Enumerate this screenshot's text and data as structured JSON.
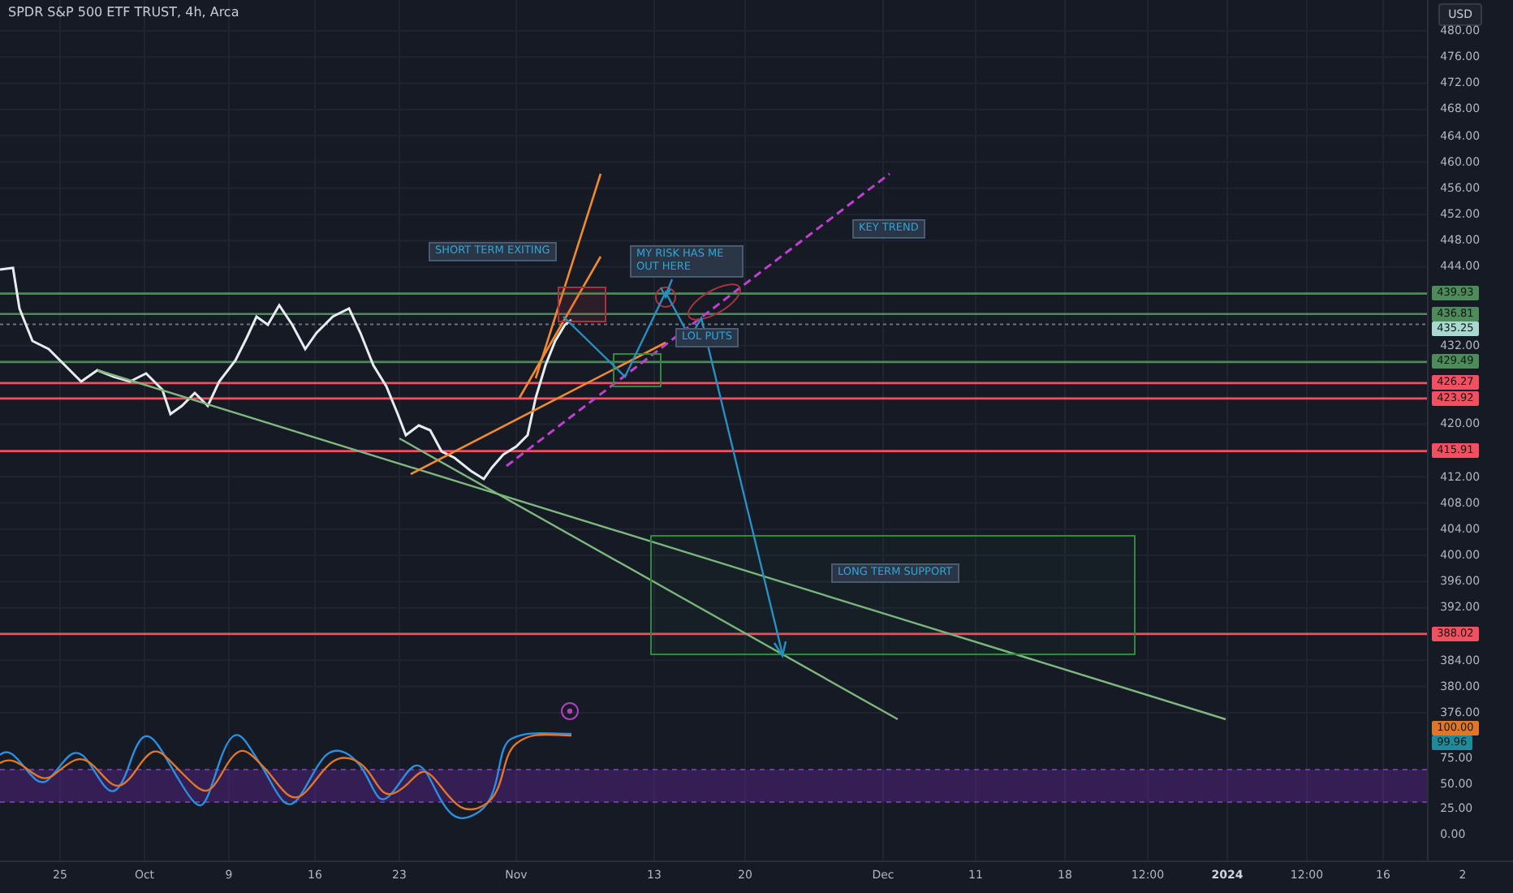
{
  "legend": {
    "title": "SPDR S&P 500 ETF TRUST, 4h, Arca"
  },
  "currency_button": "USD",
  "price_ticks": [
    "480.00",
    "476.00",
    "472.00",
    "468.00",
    "464.00",
    "460.00",
    "456.00",
    "452.00",
    "448.00",
    "444.00",
    "432.00",
    "420.00",
    "412.00",
    "408.00",
    "404.00",
    "400.00",
    "396.00",
    "392.00",
    "384.00",
    "380.00",
    "376.00"
  ],
  "levels": [
    {
      "label": "439.93",
      "color": "#4f8a5b",
      "kind": "solid"
    },
    {
      "label": "436.81",
      "color": "#4f8a5b",
      "kind": "solid"
    },
    {
      "label": "435.25",
      "color": "#a8d8d0",
      "kind": "dotted"
    },
    {
      "label": "429.49",
      "color": "#4f8a5b",
      "kind": "solid"
    },
    {
      "label": "426.27",
      "color": "#f05060",
      "kind": "solid"
    },
    {
      "label": "423.92",
      "color": "#f05060",
      "kind": "solid"
    },
    {
      "label": "415.91",
      "color": "#f05060",
      "kind": "solid"
    },
    {
      "label": "388.02",
      "color": "#f05060",
      "kind": "solid"
    }
  ],
  "oscillator": {
    "ticks": [
      "75.00",
      "50.00",
      "25.00",
      "0.00"
    ],
    "values": [
      {
        "label": "100.00",
        "color": "#e0762a"
      },
      {
        "label": "99.96",
        "color": "#1e8a9a"
      }
    ]
  },
  "notes": [
    "SHORT TERM EXITING",
    "MY RISK HAS ME OUT HERE",
    "KEY TREND",
    "LOL PUTS",
    "LONG TERM SUPPORT"
  ],
  "time_axis": [
    {
      "label": "25",
      "bold": false
    },
    {
      "label": "Oct",
      "bold": false
    },
    {
      "label": "9",
      "bold": false
    },
    {
      "label": "16",
      "bold": false
    },
    {
      "label": "23",
      "bold": false
    },
    {
      "label": "Nov",
      "bold": false
    },
    {
      "label": "13",
      "bold": false
    },
    {
      "label": "20",
      "bold": false
    },
    {
      "label": "Dec",
      "bold": false
    },
    {
      "label": "11",
      "bold": false
    },
    {
      "label": "18",
      "bold": false
    },
    {
      "label": "12:00",
      "bold": false
    },
    {
      "label": "2024",
      "bold": true
    },
    {
      "label": "12:00",
      "bold": false
    },
    {
      "label": "16",
      "bold": false
    },
    {
      "label": "2",
      "bold": false
    }
  ]
}
